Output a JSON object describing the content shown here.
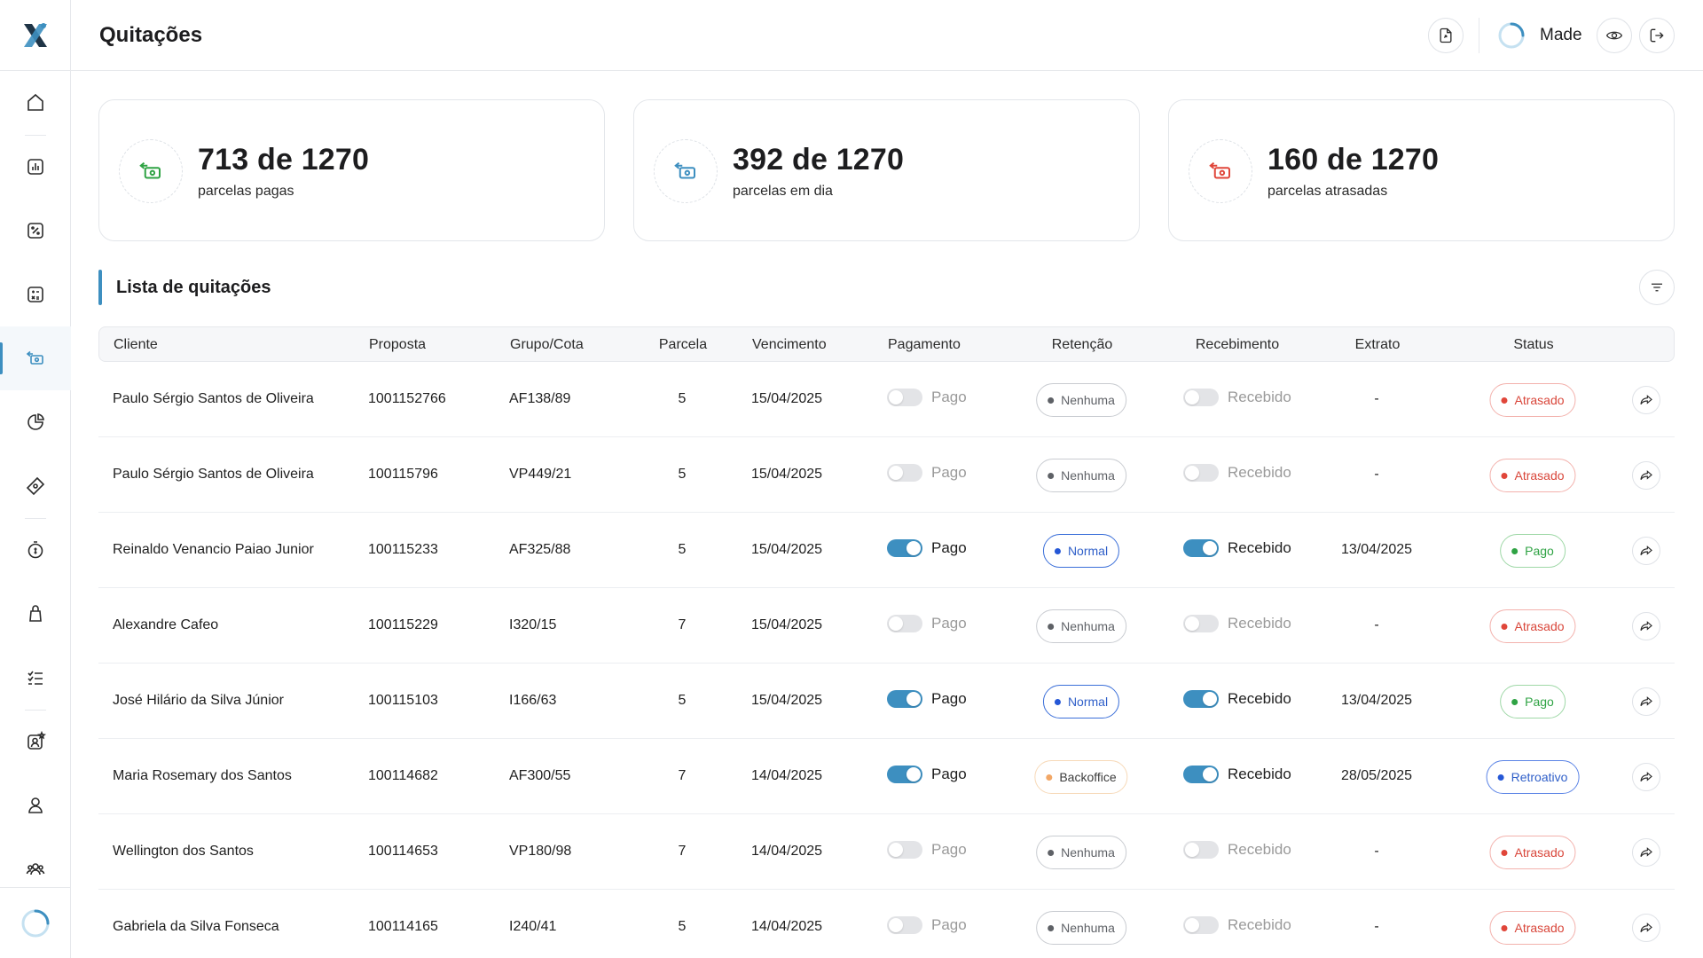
{
  "app": {
    "logo_icon": "x-logo-icon"
  },
  "header": {
    "title": "Quitações",
    "user_name": "Made",
    "export_icon": "file-export-icon",
    "eye_icon": "eye-icon",
    "logout_icon": "logout-icon"
  },
  "sidebar": {
    "items": [
      {
        "icon": "home-icon"
      },
      {
        "icon": "chart-icon"
      },
      {
        "icon": "percent-icon"
      },
      {
        "icon": "calculator-icon"
      },
      {
        "icon": "money-transfer-icon",
        "active": true
      },
      {
        "icon": "pie-chart-icon"
      },
      {
        "icon": "ticket-icon"
      },
      {
        "icon": "timer-dollar-icon"
      },
      {
        "icon": "bag-icon"
      },
      {
        "icon": "checklist-icon"
      },
      {
        "icon": "user-star-icon"
      },
      {
        "icon": "user-icon"
      },
      {
        "icon": "users-icon"
      }
    ]
  },
  "stats": [
    {
      "value": "713 de 1270",
      "label": "parcelas pagas",
      "color": "#2fa344"
    },
    {
      "value": "392 de 1270",
      "label": "parcelas em dia",
      "color": "#3d8fc0"
    },
    {
      "value": "160 de 1270",
      "label": "parcelas atrasadas",
      "color": "#e0463a"
    }
  ],
  "list": {
    "title": "Lista de quitações",
    "columns": {
      "cliente": "Cliente",
      "proposta": "Proposta",
      "grupo": "Grupo/Cota",
      "parcela": "Parcela",
      "vencimento": "Vencimento",
      "pagamento": "Pagamento",
      "retencao": "Retenção",
      "recebimento": "Recebimento",
      "extrato": "Extrato",
      "status": "Status"
    },
    "rows": [
      {
        "cliente": "Paulo Sérgio Santos de Oliveira",
        "proposta": "1001152766",
        "grupo": "AF138/89",
        "parcela": "5",
        "vencimento": "15/04/2025",
        "pagamento_label": "Pago",
        "pagamento_on": false,
        "retencao": "Nenhuma",
        "recebimento_label": "Recebido",
        "recebimento_on": false,
        "extrato": "-",
        "status": "Atrasado"
      },
      {
        "cliente": "Paulo Sérgio Santos de Oliveira",
        "proposta": "100115796",
        "grupo": "VP449/21",
        "parcela": "5",
        "vencimento": "15/04/2025",
        "pagamento_label": "Pago",
        "pagamento_on": false,
        "retencao": "Nenhuma",
        "recebimento_label": "Recebido",
        "recebimento_on": false,
        "extrato": "-",
        "status": "Atrasado"
      },
      {
        "cliente": "Reinaldo Venancio Paiao Junior",
        "proposta": "100115233",
        "grupo": "AF325/88",
        "parcela": "5",
        "vencimento": "15/04/2025",
        "pagamento_label": "Pago",
        "pagamento_on": true,
        "retencao": "Normal",
        "recebimento_label": "Recebido",
        "recebimento_on": true,
        "extrato": "13/04/2025",
        "status": "Pago"
      },
      {
        "cliente": "Alexandre Cafeo",
        "proposta": "100115229",
        "grupo": "I320/15",
        "parcela": "7",
        "vencimento": "15/04/2025",
        "pagamento_label": "Pago",
        "pagamento_on": false,
        "retencao": "Nenhuma",
        "recebimento_label": "Recebido",
        "recebimento_on": false,
        "extrato": "-",
        "status": "Atrasado"
      },
      {
        "cliente": "José Hilário da Silva Júnior",
        "proposta": "100115103",
        "grupo": "I166/63",
        "parcela": "5",
        "vencimento": "15/04/2025",
        "pagamento_label": "Pago",
        "pagamento_on": true,
        "retencao": "Normal",
        "recebimento_label": "Recebido",
        "recebimento_on": true,
        "extrato": "13/04/2025",
        "status": "Pago"
      },
      {
        "cliente": "Maria Rosemary dos Santos",
        "proposta": "100114682",
        "grupo": "AF300/55",
        "parcela": "7",
        "vencimento": "14/04/2025",
        "pagamento_label": "Pago",
        "pagamento_on": true,
        "retencao": "Backoffice",
        "recebimento_label": "Recebido",
        "recebimento_on": true,
        "extrato": "28/05/2025",
        "status": "Retroativo"
      },
      {
        "cliente": "Wellington dos Santos",
        "proposta": "100114653",
        "grupo": "VP180/98",
        "parcela": "7",
        "vencimento": "14/04/2025",
        "pagamento_label": "Pago",
        "pagamento_on": false,
        "retencao": "Nenhuma",
        "recebimento_label": "Recebido",
        "recebimento_on": false,
        "extrato": "-",
        "status": "Atrasado"
      },
      {
        "cliente": "Gabriela da Silva Fonseca",
        "proposta": "100114165",
        "grupo": "I240/41",
        "parcela": "5",
        "vencimento": "14/04/2025",
        "pagamento_label": "Pago",
        "pagamento_on": false,
        "retencao": "Nenhuma",
        "recebimento_label": "Recebido",
        "recebimento_on": false,
        "extrato": "-",
        "status": "Atrasado"
      }
    ]
  },
  "colors": {
    "accent": "#3d8fc0",
    "paid": "#2fa344",
    "late": "#e0463a",
    "normal": "#2557d6",
    "backoffice": "#f2a766"
  }
}
